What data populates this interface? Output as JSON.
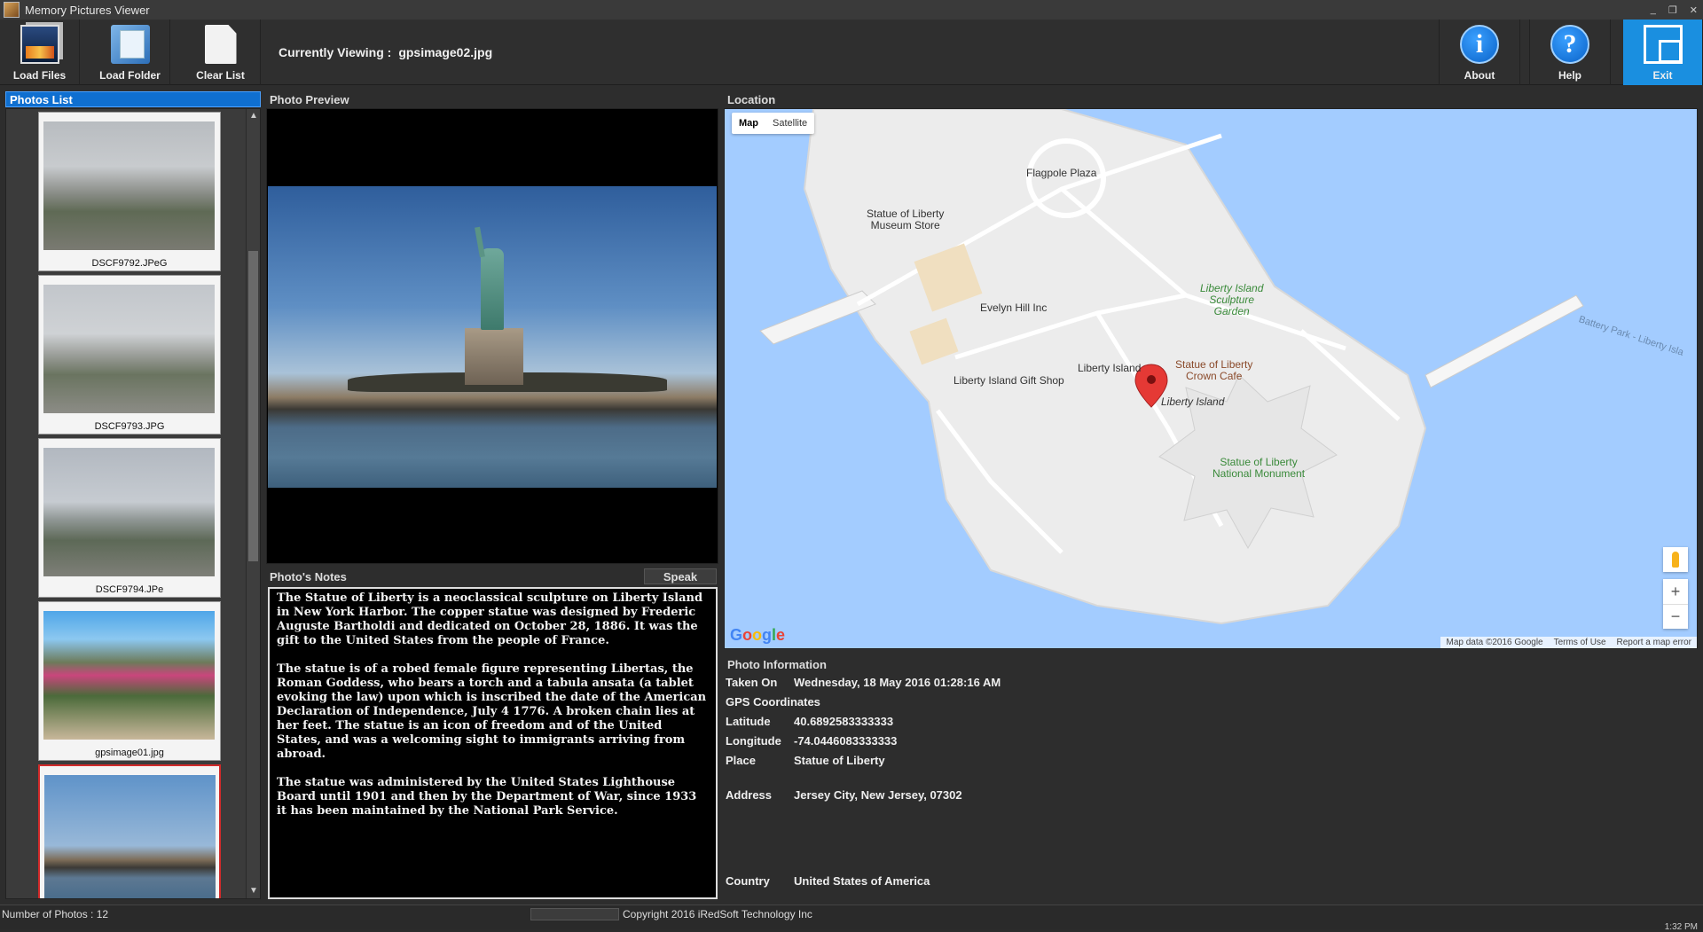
{
  "window": {
    "title": "Memory Pictures Viewer",
    "minimize": "_",
    "restore": "❐",
    "close": "✕"
  },
  "toolbar": {
    "load_files": "Load Files",
    "load_folder": "Load Folder",
    "clear_list": "Clear List",
    "currently_viewing_label": "Currently Viewing :",
    "current_file": "gpsimage02.jpg",
    "about": "About",
    "help": "Help",
    "exit": "Exit",
    "about_glyph": "i",
    "help_glyph": "?"
  },
  "photos_list": {
    "title": "Photos List",
    "items": [
      {
        "name": "DSCF9792.JPeG",
        "selected": false
      },
      {
        "name": "DSCF9793.JPG",
        "selected": false
      },
      {
        "name": "DSCF9794.JPe",
        "selected": false
      },
      {
        "name": "gpsimage01.jpg",
        "selected": false
      },
      {
        "name": "",
        "selected": true
      }
    ]
  },
  "preview": {
    "title": "Photo Preview"
  },
  "notes": {
    "title": "Photo's Notes",
    "speak": "Speak",
    "paragraphs": [
      "The Statue of Liberty is a neoclassical sculpture on Liberty Island in New York Harbor. The copper statue was designed by Frederic Auguste Bartholdi and dedicated on October 28, 1886. It was the gift to the United States from the people of France.",
      "The statue is of a robed female figure representing Libertas, the Roman Goddess, who bears a torch and a tabula ansata (a tablet evoking the law) upon which is inscribed the date of the American Declaration of Independence, July 4 1776. A broken chain lies at her feet. The statue is an icon of freedom and of the United States, and was a welcoming sight to immigrants arriving from abroad.",
      "The statue was administered by the United States Lighthouse Board until 1901 and then by the Department of War, since 1933 it has been maintained by the National Park Service."
    ]
  },
  "location": {
    "title": "Location",
    "map_tab": "Map",
    "satellite_tab": "Satellite",
    "labels": {
      "flagpole": "Flagpole Plaza",
      "museum_store": "Statue of Liberty\nMuseum Store",
      "evelyn": "Evelyn Hill Inc",
      "sculpture_garden": "Liberty Island\nSculpture\nGarden",
      "liberty_island_poi": "Liberty Island",
      "crown_cafe": "Statue of Liberty\nCrown Cafe",
      "gift_shop": "Liberty Island Gift Shop",
      "liberty_island": "Liberty Island",
      "monument": "Statue of Liberty\nNational Monument",
      "battery_park": "Battery Park - Liberty Isla"
    },
    "zoom_in": "+",
    "zoom_out": "−",
    "google": [
      "G",
      "o",
      "o",
      "g",
      "l",
      "e"
    ],
    "footer": {
      "map_data": "Map data ©2016 Google",
      "terms": "Terms of Use",
      "report": "Report a map error"
    }
  },
  "photo_info": {
    "title": "Photo Information",
    "taken_on_label": "Taken On",
    "taken_on": "Wednesday, 18 May 2016 01:28:16 AM",
    "gps_label": "GPS Coordinates",
    "latitude_label": "Latitude",
    "latitude": "40.6892583333333",
    "longitude_label": "Longitude",
    "longitude": "-74.0446083333333",
    "place_label": "Place",
    "place": "Statue of Liberty",
    "address_label": "Address",
    "address": "Jersey City, New Jersey, 07302",
    "country_label": "Country",
    "country": "United States of America"
  },
  "status": {
    "count": "Number of Photos : 12",
    "copyright": "Copyright 2016 iRedSoft Technology Inc",
    "clock": "1:32 PM"
  },
  "colors": {
    "selection_blue": "#0f6fd0",
    "selected_thumb_border": "#d12a2a",
    "map_water": "#a3ccff",
    "map_land": "#ececec",
    "marker_red": "#e53935"
  }
}
